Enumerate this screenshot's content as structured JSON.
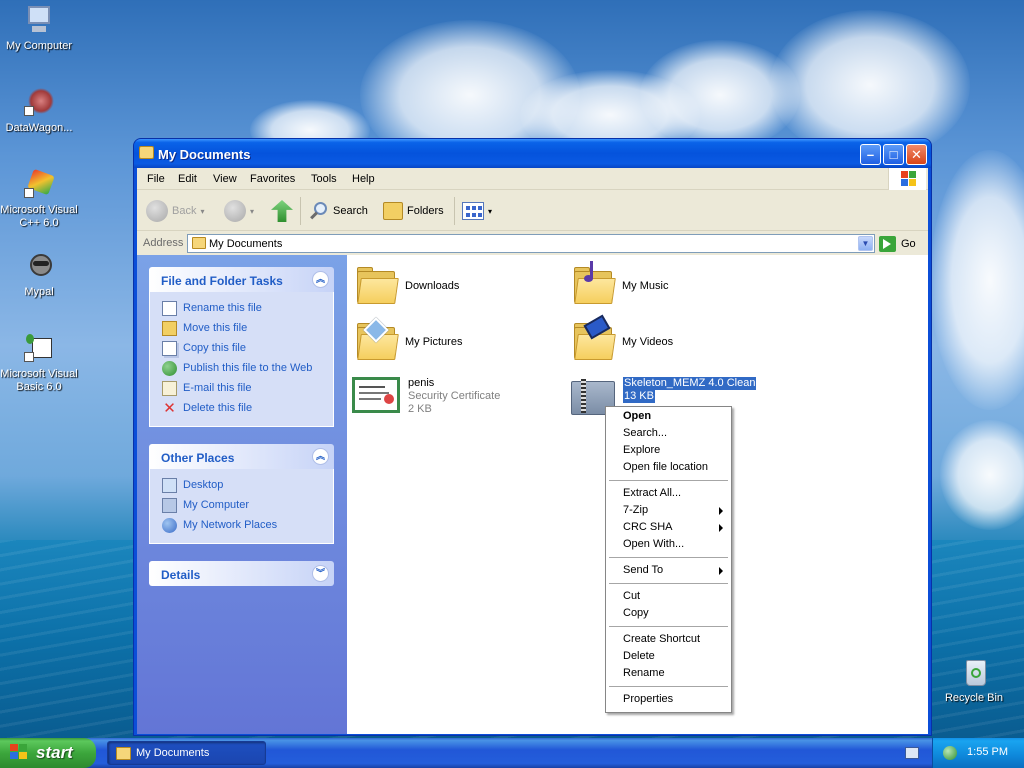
{
  "desktop": {
    "icons": [
      {
        "label": "My Computer"
      },
      {
        "label": "DataWagon..."
      },
      {
        "label": "Microsoft Visual C++ 6.0"
      },
      {
        "label": "Mypal"
      },
      {
        "label": "Microsoft Visual Basic 6.0"
      },
      {
        "label": "Recycle Bin"
      }
    ]
  },
  "window": {
    "title": "My Documents",
    "menu": [
      "File",
      "Edit",
      "View",
      "Favorites",
      "Tools",
      "Help"
    ],
    "toolbar": {
      "back": "Back",
      "search": "Search",
      "folders": "Folders"
    },
    "address": {
      "label": "Address",
      "value": "My Documents",
      "go": "Go"
    }
  },
  "taskpane": {
    "file_tasks": {
      "title": "File and Folder Tasks",
      "items": [
        "Rename this file",
        "Move this file",
        "Copy this file",
        "Publish this file to the Web",
        "E-mail this file",
        "Delete this file"
      ]
    },
    "other_places": {
      "title": "Other Places",
      "items": [
        "Desktop",
        "My Computer",
        "My Network Places"
      ]
    },
    "details": {
      "title": "Details"
    }
  },
  "files": [
    {
      "name": "Downloads"
    },
    {
      "name": "My Music"
    },
    {
      "name": "My Pictures"
    },
    {
      "name": "My Videos"
    },
    {
      "name": "penis",
      "type": "Security Certificate",
      "size": "2 KB"
    },
    {
      "name": "Skeleton_MEMZ 4.0 Clean",
      "size": "13 KB"
    }
  ],
  "context_menu": {
    "items": [
      "Open",
      "Search...",
      "Explore",
      "Open file location",
      "Extract All...",
      "7-Zip",
      "CRC SHA",
      "Open With...",
      "Send To",
      "Cut",
      "Copy",
      "Create Shortcut",
      "Delete",
      "Rename",
      "Properties"
    ]
  },
  "taskbar": {
    "start": "start",
    "task": "My Documents",
    "clock": "1:55 PM"
  }
}
